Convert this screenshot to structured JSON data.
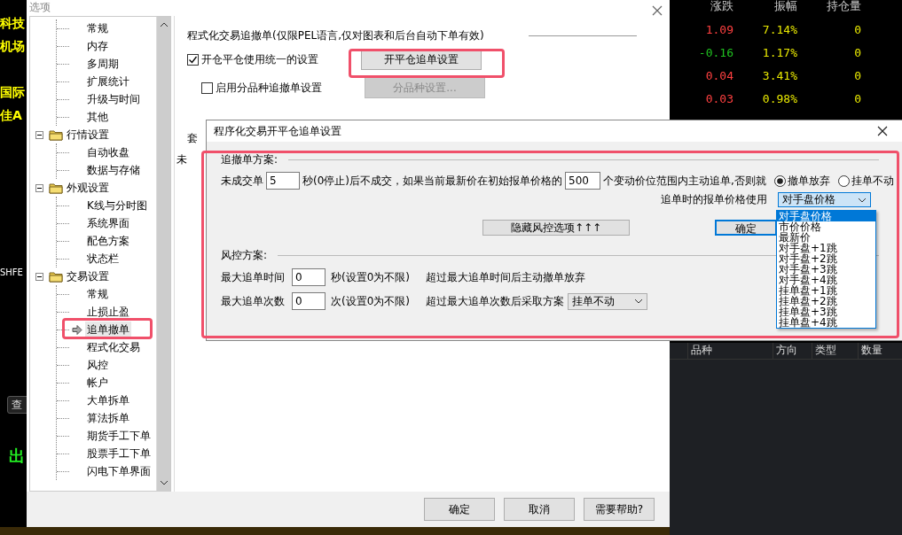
{
  "background": {
    "left_labels": [
      {
        "text": "科技",
        "color": "#ffff00"
      },
      {
        "text": "机场",
        "color": "#ffff00"
      },
      {
        "text": "国际",
        "color": "#ffff00"
      },
      {
        "text": "佳A",
        "color": "#ffff00"
      },
      {
        "text": "SHFE",
        "color": "#ffffff"
      }
    ],
    "query_button": "查",
    "sell_label": "出",
    "quote_header": [
      "涨跌",
      "振幅",
      "持仓量"
    ],
    "quote_rows": [
      {
        "change": "1.09",
        "up": true,
        "amplitude": "7.14%",
        "open_interest": "0"
      },
      {
        "change": "-0.16",
        "up": false,
        "amplitude": "1.17%",
        "open_interest": "0"
      },
      {
        "change": "0.04",
        "up": true,
        "amplitude": "3.41%",
        "open_interest": "0"
      },
      {
        "change": "0.03",
        "up": true,
        "amplitude": "0.98%",
        "open_interest": "0"
      }
    ],
    "order_columns": [
      "品种",
      "方向",
      "类型",
      "数量"
    ]
  },
  "options_dialog": {
    "title": "选项",
    "tree": [
      {
        "children": [
          {
            "label": "常规",
            "selected": false
          },
          {
            "label": "内存",
            "selected": false
          },
          {
            "label": "多周期",
            "selected": false
          },
          {
            "label": "扩展统计",
            "selected": false
          },
          {
            "label": "升级与时间",
            "selected": false
          },
          {
            "label": "其他",
            "selected": false
          }
        ]
      },
      {
        "label": "行情设置",
        "expanded": true,
        "children": [
          {
            "label": "自动收盘",
            "selected": false
          },
          {
            "label": "数据与存储",
            "selected": false
          }
        ]
      },
      {
        "label": "外观设置",
        "expanded": true,
        "children": [
          {
            "label": "K线与分时图",
            "selected": false
          },
          {
            "label": "系统界面",
            "selected": false
          },
          {
            "label": "配色方案",
            "selected": false
          },
          {
            "label": "状态栏",
            "selected": false
          }
        ]
      },
      {
        "label": "交易设置",
        "expanded": true,
        "children": [
          {
            "label": "常规",
            "selected": false
          },
          {
            "label": "止损止盈",
            "selected": false
          },
          {
            "label": "追单撤单",
            "selected": true
          },
          {
            "label": "程式化交易",
            "selected": false
          },
          {
            "label": "风控",
            "selected": false
          },
          {
            "label": "帐户",
            "selected": false
          },
          {
            "label": "大单拆单",
            "selected": false
          },
          {
            "label": "算法拆单",
            "selected": false
          },
          {
            "label": "期货手工下单",
            "selected": false
          },
          {
            "label": "股票手工下单",
            "selected": false
          },
          {
            "label": "闪电下单界面",
            "selected": false
          }
        ]
      }
    ],
    "section_title": "程式化交易追撤单(仅限PEL语言,仅对图表和后台自动下单有效)",
    "unified_setting": {
      "label": "开仓平仓使用统一的设置",
      "checked": true
    },
    "open_close_button": "开平仓追单设置",
    "per_product": {
      "label": "启用分品种追撤单设置",
      "checked": false
    },
    "per_product_button": {
      "label": "分品种设置...",
      "disabled": true
    },
    "covered_texts": [
      "套",
      "未"
    ],
    "buttons": [
      "确定",
      "取消",
      "需要帮助?"
    ]
  },
  "chase_dialog": {
    "title": "程序化交易开平仓追单设置",
    "chase_section": "追撤单方案:",
    "unfilled_label": "未成交单",
    "seconds_value": "5",
    "seconds_text": "秒(0停止)后不成交，如果当前最新价在初始报单价格的",
    "ticks_value": "500",
    "ticks_text": "个变动价位范围内主动追单,否则就",
    "radios": [
      {
        "label": "撤单放弃",
        "selected": true
      },
      {
        "label": "挂单不动",
        "selected": false
      }
    ],
    "price_label": "追单时的报单价格使用",
    "price_value": "对手盘价格",
    "price_options": [
      {
        "label": "对手盘价格",
        "selected": true
      },
      {
        "label": "市价价格",
        "selected": false
      },
      {
        "label": "最新价",
        "selected": false
      },
      {
        "label": "对手盘+1跳",
        "selected": false
      },
      {
        "label": "对手盘+2跳",
        "selected": false
      },
      {
        "label": "对手盘+3跳",
        "selected": false
      },
      {
        "label": "对手盘+4跳",
        "selected": false
      },
      {
        "label": "挂单盘+1跳",
        "selected": false
      },
      {
        "label": "挂单盘+2跳",
        "selected": false
      },
      {
        "label": "挂单盘+3跳",
        "selected": false
      },
      {
        "label": "挂单盘+4跳",
        "selected": false
      }
    ],
    "hide_button": "隐藏风控选项↑↑↑",
    "ok_button": "确定",
    "risk_section": "风控方案:",
    "risk_rows": [
      {
        "label": "最大追单时间",
        "value": "0",
        "unit": "秒(设置0为不限)",
        "note": "超过最大追单时间后主动撤单放弃"
      },
      {
        "label": "最大追单次数",
        "value": "0",
        "unit": "次(设置0为不限)",
        "note": "超过最大追单次数后采取方案",
        "select": "挂单不动"
      }
    ]
  }
}
